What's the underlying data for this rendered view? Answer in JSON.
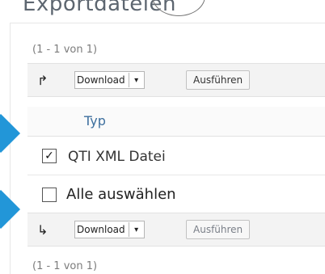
{
  "header": {
    "title": "Exportdateien"
  },
  "pager": {
    "top": "(1 - 1 von 1)",
    "bottom": "(1 - 1 von 1)"
  },
  "toolbar_top": {
    "select_value": "Download",
    "button_label": "Ausführen",
    "arrow_icon": "arrow-up-right"
  },
  "table": {
    "column_header": "Typ"
  },
  "rows": [
    {
      "label": "QTI XML Datei",
      "checked": true
    }
  ],
  "select_all": {
    "label": "Alle auswählen",
    "checked": false
  },
  "toolbar_bottom": {
    "select_value": "Download",
    "button_label": "Ausführen",
    "arrow_icon": "arrow-down-right"
  },
  "colors": {
    "accent_arrow": "#2296d8",
    "link_blue": "#3d6f9e",
    "toolbar_bg": "#f3f3f3"
  }
}
